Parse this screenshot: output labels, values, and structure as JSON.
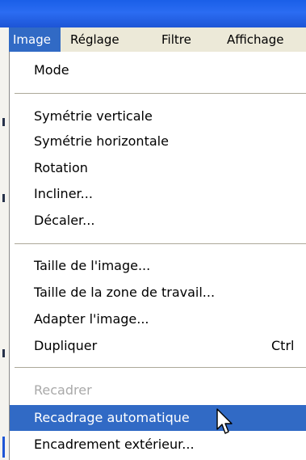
{
  "menubar": {
    "items": [
      {
        "label": "Image",
        "active": true
      },
      {
        "label": "Réglage",
        "active": false
      },
      {
        "label": "Filtre",
        "active": false
      },
      {
        "label": "Affichage",
        "active": false
      }
    ]
  },
  "menu": {
    "mode": "Mode",
    "flip_vertical": "Symétrie verticale",
    "flip_horizontal": "Symétrie horizontale",
    "rotation": "Rotation",
    "skew": "Incliner...",
    "offset": "Décaler...",
    "image_size": "Taille de l'image...",
    "canvas_size": "Taille de la zone de travail...",
    "fit_image": "Adapter l'image...",
    "duplicate": "Dupliquer",
    "duplicate_shortcut": "Ctrl",
    "crop": "Recadrer",
    "crop_state": "disabled",
    "auto_crop": "Recadrage automatique",
    "auto_crop_state": "highlighted",
    "outer_frame": "Encadrement extérieur..."
  },
  "colors": {
    "highlight": "#316ac5",
    "menubar_bg": "#ece9d8",
    "titlebar": "#2b6cf2",
    "disabled_text": "#a9a9a9"
  },
  "icons": {
    "cursor": "mouse-pointer-icon"
  }
}
